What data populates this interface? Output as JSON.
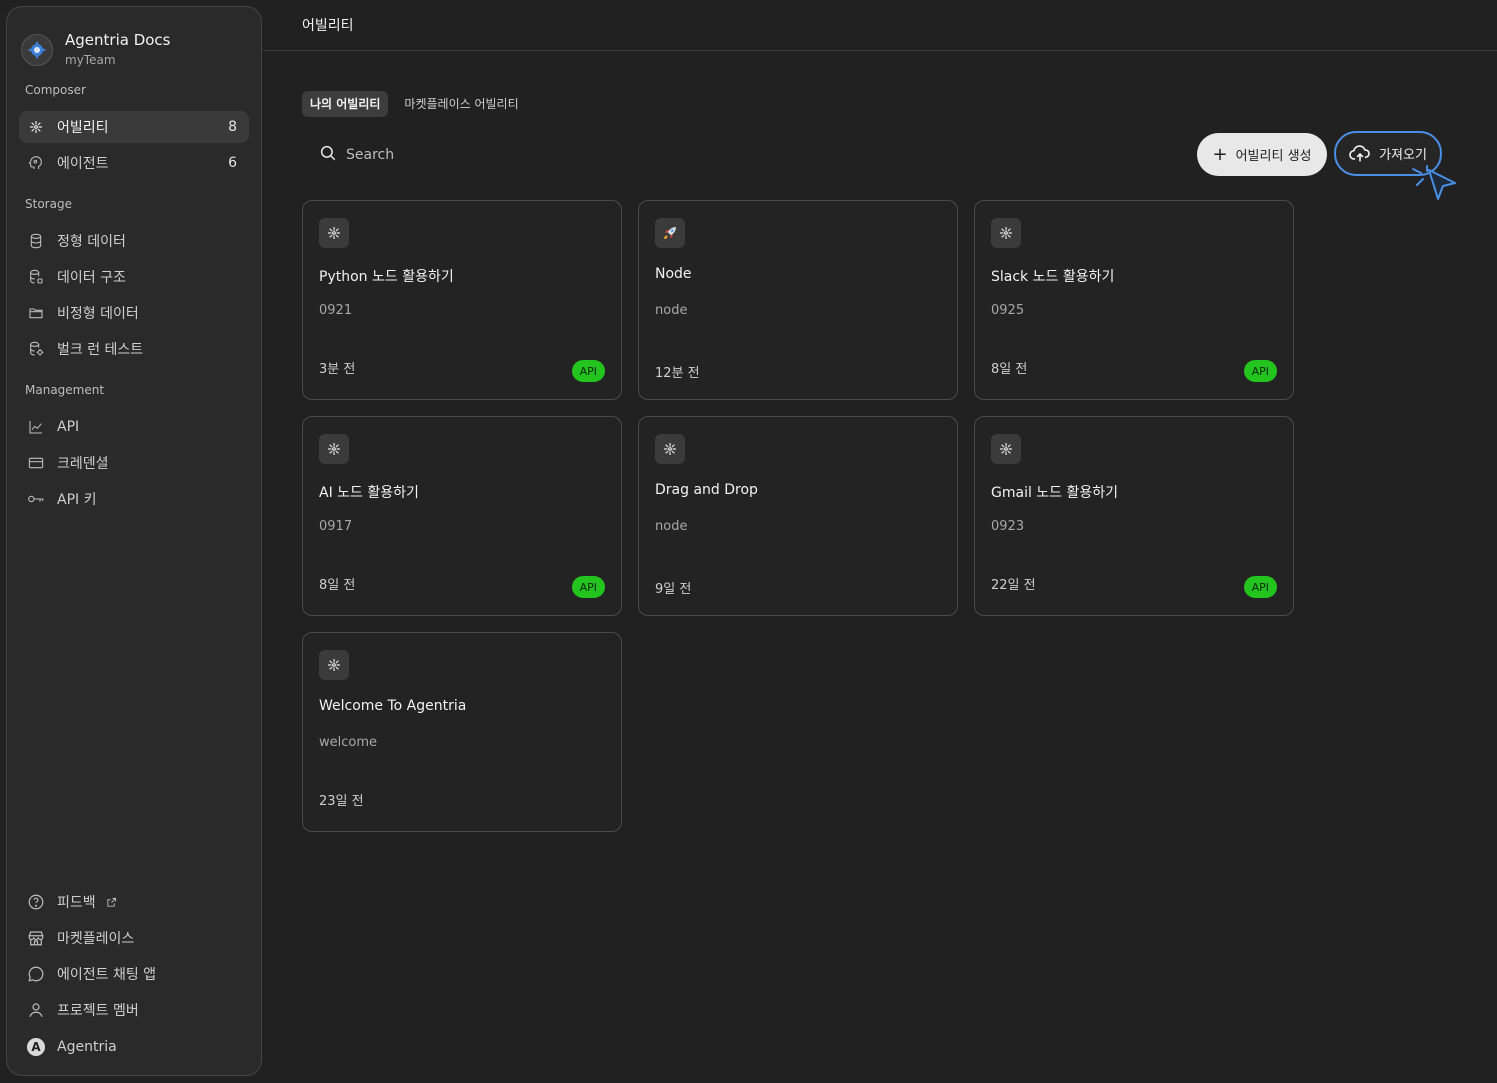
{
  "workspace": {
    "title": "Agentria Docs",
    "team": "myTeam"
  },
  "sidebar": {
    "sections": [
      {
        "label": "Composer",
        "items": [
          {
            "label": "어빌리티",
            "count": "8",
            "icon": "ability-icon",
            "active": true
          },
          {
            "label": "에이전트",
            "count": "6",
            "icon": "agent-brain-icon"
          }
        ]
      },
      {
        "label": "Storage",
        "items": [
          {
            "label": "정형 데이터",
            "icon": "database-icon"
          },
          {
            "label": "데이터 구조",
            "icon": "database-schema-icon"
          },
          {
            "label": "비정형 데이터",
            "icon": "folder-icon"
          },
          {
            "label": "벌크 런 테스트",
            "icon": "database-test-icon"
          }
        ]
      },
      {
        "label": "Management",
        "items": [
          {
            "label": "API",
            "icon": "line-chart-icon"
          },
          {
            "label": "크레덴셜",
            "icon": "credit-card-icon"
          },
          {
            "label": "API 키",
            "icon": "key-icon"
          }
        ]
      }
    ],
    "bottom": [
      {
        "label": "피드백",
        "icon": "help-circle-icon",
        "external": true
      },
      {
        "label": "마켓플레이스",
        "icon": "store-icon"
      },
      {
        "label": "에이전트 채팅 앱",
        "icon": "chat-bubble-icon"
      },
      {
        "label": "프로젝트 멤버",
        "icon": "user-icon"
      },
      {
        "label": "Agentria",
        "icon": "avatar",
        "avatar_letter": "A"
      }
    ]
  },
  "header": {
    "title": "어빌리티"
  },
  "tabs": [
    {
      "label": "나의 어빌리티",
      "active": true
    },
    {
      "label": "마켓플레이스 어빌리티"
    }
  ],
  "search": {
    "placeholder": "Search"
  },
  "actions": {
    "create_label": "어빌리티 생성",
    "import_label": "가져오기"
  },
  "cards": [
    {
      "title": "Python 노드 활용하기",
      "subtitle": "0921",
      "time": "3분 전",
      "badge": "API",
      "icon": "ability-icon"
    },
    {
      "title": "Node",
      "subtitle": "node",
      "time": "12분 전",
      "badge": null,
      "icon": "rocket-icon"
    },
    {
      "title": "Slack 노드 활용하기",
      "subtitle": "0925",
      "time": "8일 전",
      "badge": "API",
      "icon": "ability-icon"
    },
    {
      "title": "AI 노드 활용하기",
      "subtitle": "0917",
      "time": "8일 전",
      "badge": "API",
      "icon": "ability-icon"
    },
    {
      "title": "Drag and Drop",
      "subtitle": "node",
      "time": "9일 전",
      "badge": null,
      "icon": "ability-icon"
    },
    {
      "title": "Gmail 노드 활용하기",
      "subtitle": "0923",
      "time": "22일 전",
      "badge": "API",
      "icon": "ability-icon"
    },
    {
      "title": "Welcome To Agentria",
      "subtitle": "welcome",
      "time": "23일 전",
      "badge": null,
      "icon": "ability-icon"
    }
  ],
  "colors": {
    "accent": "#4a8fe6",
    "badge": "#22c41d",
    "background": "#212121",
    "sidebar": "#2a2a2a"
  }
}
